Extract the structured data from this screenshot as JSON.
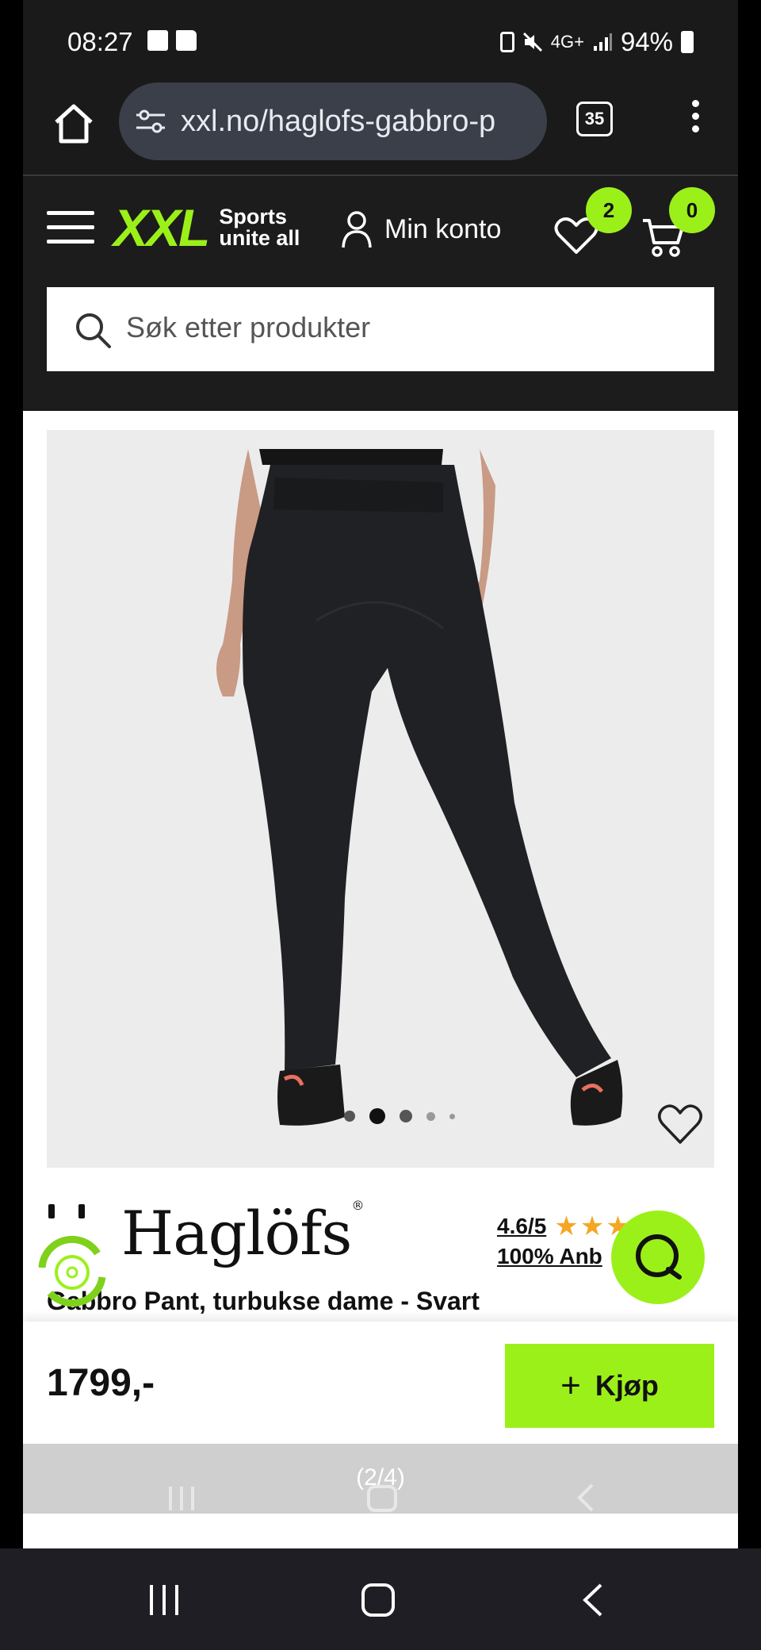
{
  "status_bar": {
    "time": "08:27",
    "network": "4G+",
    "battery": "94%",
    "icons": [
      "image-icon",
      "folder-icon",
      "nfc-icon",
      "mute-icon",
      "signal-icon",
      "battery-icon"
    ]
  },
  "browser": {
    "url": "xxl.no/haglofs-gabbro-p",
    "tab_count": "35"
  },
  "header": {
    "logo_text": "XXL",
    "logo_tagline_1": "Sports",
    "logo_tagline_2": "unite all",
    "account_label": "Min konto",
    "wishlist_count": "2",
    "cart_count": "0",
    "search_placeholder": "Søk etter produkter"
  },
  "product": {
    "brand": "Haglöfs",
    "brand_mark": "®",
    "rating": "4.6/5",
    "stars_filled": 4,
    "recommend": "100% Anb",
    "title": "Gabbro Pant, turbukse dame - Svart",
    "price": "1799,-",
    "buy_label": "Kjøp",
    "gallery_index": 2,
    "gallery_count": 5
  },
  "overlay": {
    "page_indicator": "(2/4)"
  },
  "colors": {
    "accent": "#9cf01a",
    "header_bg": "#1c1c1c",
    "star": "#f5a623"
  }
}
